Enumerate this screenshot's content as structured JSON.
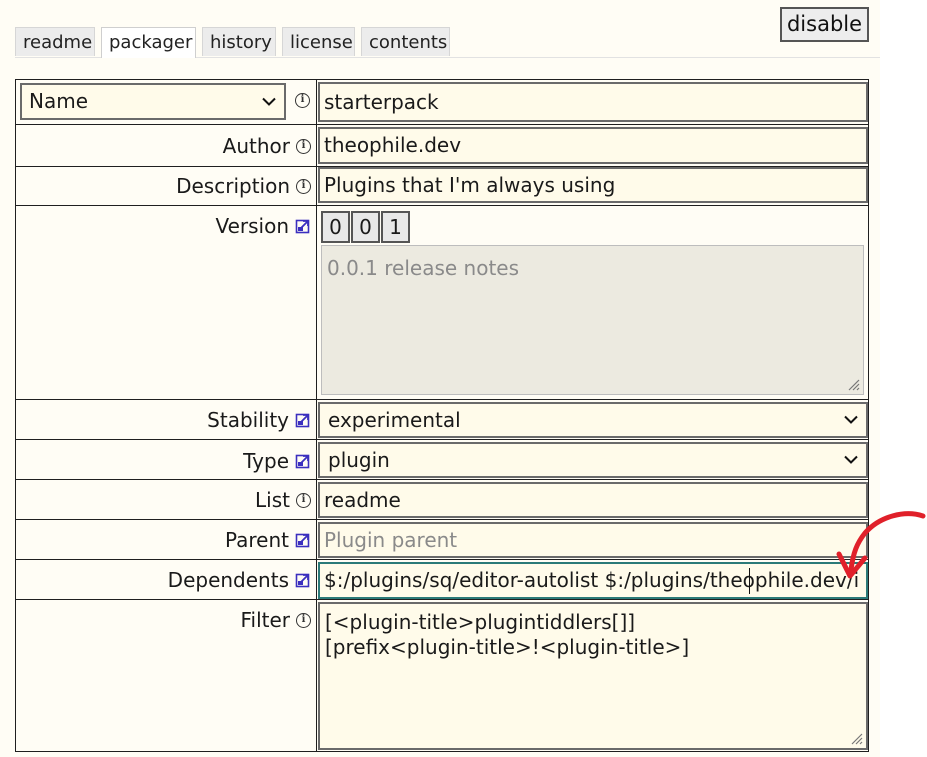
{
  "tabs": [
    "readme",
    "packager",
    "history",
    "license",
    "contents"
  ],
  "active_tab": "packager",
  "disable_button": "disable",
  "name_select": {
    "selected": "Name"
  },
  "fields": {
    "name": "starterpack",
    "author_label": "Author",
    "author": "theophile.dev",
    "description_label": "Description",
    "description": "Plugins that I'm always using",
    "version_label": "Version",
    "version": [
      "0",
      "0",
      "1"
    ],
    "release_notes_placeholder": "0.0.1 release notes",
    "stability_label": "Stability",
    "stability": "experimental",
    "type_label": "Type",
    "type": "plugin",
    "list_label": "List",
    "list": "readme",
    "parent_label": "Parent",
    "parent_placeholder": "Plugin parent",
    "dependents_label": "Dependents",
    "dependents": "$:/plugins/sq/editor-autolist $:/plugins/theophile.dev/i",
    "filter_label": "Filter",
    "filter_lines": [
      "[<plugin-title>plugintiddlers[]]",
      "[prefix<plugin-title>!<plugin-title>]"
    ]
  },
  "colors": {
    "panel_bg": "#fffdf5",
    "field_bg": "#fffbea",
    "link_icon": "#3b2fbf",
    "arrow_annotation": "#e0202a",
    "focus_border": "#2b7a78"
  },
  "icons": {
    "info": "info-circle-icon",
    "external": "external-link-icon",
    "chevron": "chevron-down-icon",
    "annotation": "red-arrow-annotation"
  }
}
